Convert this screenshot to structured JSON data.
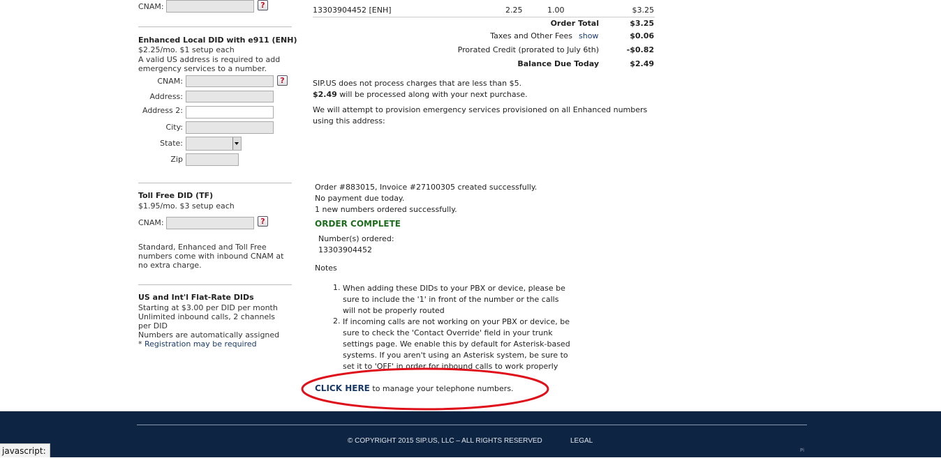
{
  "left": {
    "top_cnam_label": "CNAM:",
    "enh": {
      "title": "Enhanced Local DID with e911 (ENH)",
      "price": "$2.25/mo. $1 setup each",
      "note": "A valid US address is required to add emergency services to a number.",
      "cnam_label": "CNAM:",
      "address_label": "Address:",
      "address2_label": "Address 2:",
      "city_label": "City:",
      "state_label": "State:",
      "zip_label": "Zip"
    },
    "tf": {
      "title": "Toll Free DID (TF)",
      "price": "$1.95/mo. $3 setup each",
      "cnam_label": "CNAM:",
      "cnam_note": "Standard, Enhanced and Toll Free numbers come with inbound CNAM at no extra charge."
    },
    "flat": {
      "title": "US and Int'l Flat-Rate DIDs",
      "line1": "Starting at $3.00 per DID per month",
      "line2": "Unlimited inbound calls, 2 channels per DID",
      "line3": "Numbers are automatically assigned",
      "asterisk": "* ",
      "reg_link": "Registration may be required"
    },
    "help_glyph": "?"
  },
  "order": {
    "item": {
      "desc": "13303904452 [ENH]",
      "price": "2.25",
      "qty": "1.00",
      "total": "$3.25"
    },
    "order_total_label": "Order Total",
    "order_total": "$3.25",
    "taxes_label": "Taxes and Other Fees",
    "taxes_link": "show",
    "taxes": "$0.06",
    "prorated_label": "Prorated Credit (prorated to July 6th)",
    "prorated": "-$0.82",
    "balance_label": "Balance Due Today",
    "balance": "$2.49",
    "notice1": "SIP.US does not process charges that are less than $5.",
    "notice2_amount": "$2.49",
    "notice2_rest": " will be processed along with your next purchase.",
    "e911_notice": "We will attempt to provision emergency services provisioned on all Enhanced numbers using this address:"
  },
  "result": {
    "line1": "Order #883015, Invoice #27100305 created successfully.",
    "line2": "No payment due today.",
    "line3": "1 new numbers ordered successfully.",
    "complete": "ORDER COMPLETE",
    "numbers_label": "Number(s) ordered:",
    "number": "13303904452",
    "notes_title": "Notes",
    "note1_num": "1.",
    "note1": "When adding these DIDs to your PBX or device, please be sure to include the '1' in front of the number or the calls will not be properly routed",
    "note2_num": "2.",
    "note2": "If incoming calls are not working on your PBX or device, be sure to check the 'Contact Override' field in your trunk settings page. We enable this by default for Asterisk-based systems. If you aren't using an Asterisk system, be sure to set it to 'OFF' in order for inbound calls to work properly",
    "click_here": "CLICK HERE",
    "click_rest": " to manage your telephone numbers."
  },
  "footer": {
    "copyright": "© COPYRIGHT 2015 SIP.US, LLC – ALL RIGHTS RESERVED",
    "legal": "LEGAL",
    "corner": "Pi"
  },
  "statusbar": {
    "text": "javascript:"
  },
  "colors": {
    "footer_bg": "#0e2443",
    "order_complete": "#1f6e1f",
    "link": "#1a3a6b",
    "annotation": "#e0101a"
  }
}
